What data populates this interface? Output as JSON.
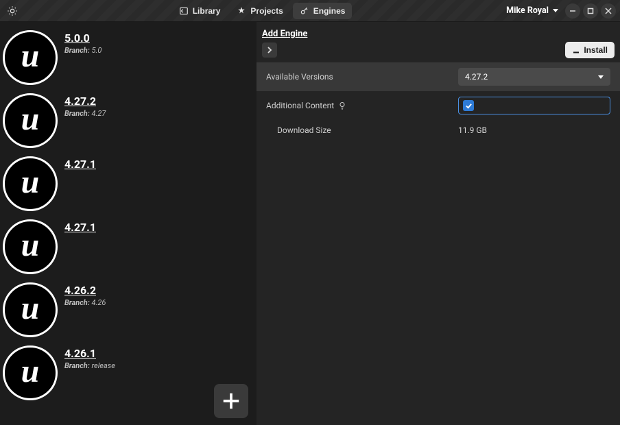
{
  "titlebar": {
    "nav": {
      "library": "Library",
      "projects": "Projects",
      "engines": "Engines"
    },
    "user": "Mike Royal"
  },
  "sidebar": {
    "engines": [
      {
        "version": "5.0.0",
        "branch": "5.0"
      },
      {
        "version": "4.27.2",
        "branch": "4.27"
      },
      {
        "version": "4.27.1",
        "branch": null
      },
      {
        "version": "4.27.1",
        "branch": null
      },
      {
        "version": "4.26.2",
        "branch": "4.26"
      },
      {
        "version": "4.26.1",
        "branch": "release"
      }
    ],
    "branch_label": "Branch:"
  },
  "panel": {
    "title": "Add Engine",
    "install_label": "Install",
    "rows": {
      "available_versions_label": "Available Versions",
      "available_versions_value": "4.27.2",
      "additional_content_label": "Additional Content",
      "download_size_label": "Download Size",
      "download_size_value": "11.9 GB"
    }
  }
}
